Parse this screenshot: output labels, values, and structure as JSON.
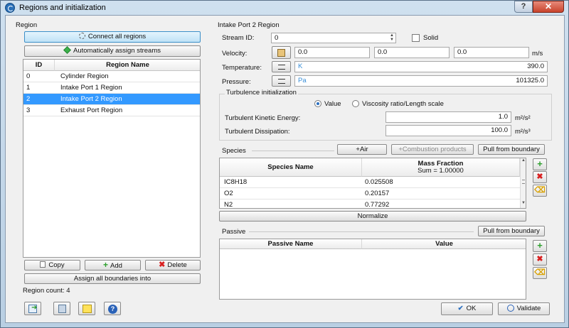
{
  "window": {
    "title": "Regions and initialization",
    "help_label": "?",
    "close_label": "✕"
  },
  "left": {
    "group_label": "Region",
    "connect_all_label": "Connect all regions",
    "auto_assign_label": "Automatically assign streams",
    "table": {
      "headers": [
        "ID",
        "Region Name"
      ],
      "rows": [
        {
          "id": "0",
          "name": "Cylinder Region"
        },
        {
          "id": "1",
          "name": "Intake Port 1 Region"
        },
        {
          "id": "2",
          "name": "Intake Port 2 Region",
          "selected": true
        },
        {
          "id": "3",
          "name": "Exhaust Port Region"
        }
      ]
    },
    "copy_label": "Copy",
    "add_label": "Add",
    "delete_label": "Delete",
    "assign_all_label": "Assign all boundaries into",
    "region_count": "Region count: 4"
  },
  "right": {
    "group_label": "Intake Port 2 Region",
    "stream_id_label": "Stream ID:",
    "stream_id_value": "0",
    "solid_label": "Solid",
    "velocity_label": "Velocity:",
    "velocity": [
      "0.0",
      "0.0",
      "0.0"
    ],
    "velocity_unit": "m/s",
    "temperature_label": "Temperature:",
    "temperature_unit": "K",
    "temperature_value": "390.0",
    "pressure_label": "Pressure:",
    "pressure_unit": "Pa",
    "pressure_value": "101325.0",
    "turbulence": {
      "group_label": "Turbulence initialization",
      "value_label": "Value",
      "viscosity_label": "Viscosity ratio/Length scale",
      "tke_label": "Turbulent Kinetic Energy:",
      "tke_value": "1.0",
      "tke_unit": "m²/s²",
      "diss_label": "Turbulent Dissipation:",
      "diss_value": "100.0",
      "diss_unit": "m²/s³"
    },
    "species": {
      "label": "Species",
      "air_label": "+Air",
      "combustion_label": "+Combustion products",
      "pull_label": "Pull from boundary",
      "headers": [
        "Species Name",
        "Mass Fraction",
        "Sum = 1.00000"
      ],
      "rows": [
        {
          "name": "IC8H18",
          "fraction": "0.025508"
        },
        {
          "name": "O2",
          "fraction": "0.20157"
        },
        {
          "name": "N2",
          "fraction": "0.77292"
        }
      ],
      "normalize_label": "Normalize"
    },
    "passive": {
      "label": "Passive",
      "pull_label": "Pull from boundary",
      "headers": [
        "Passive Name",
        "Value"
      ]
    }
  },
  "bottom": {
    "ok_label": "OK",
    "validate_label": "Validate"
  }
}
